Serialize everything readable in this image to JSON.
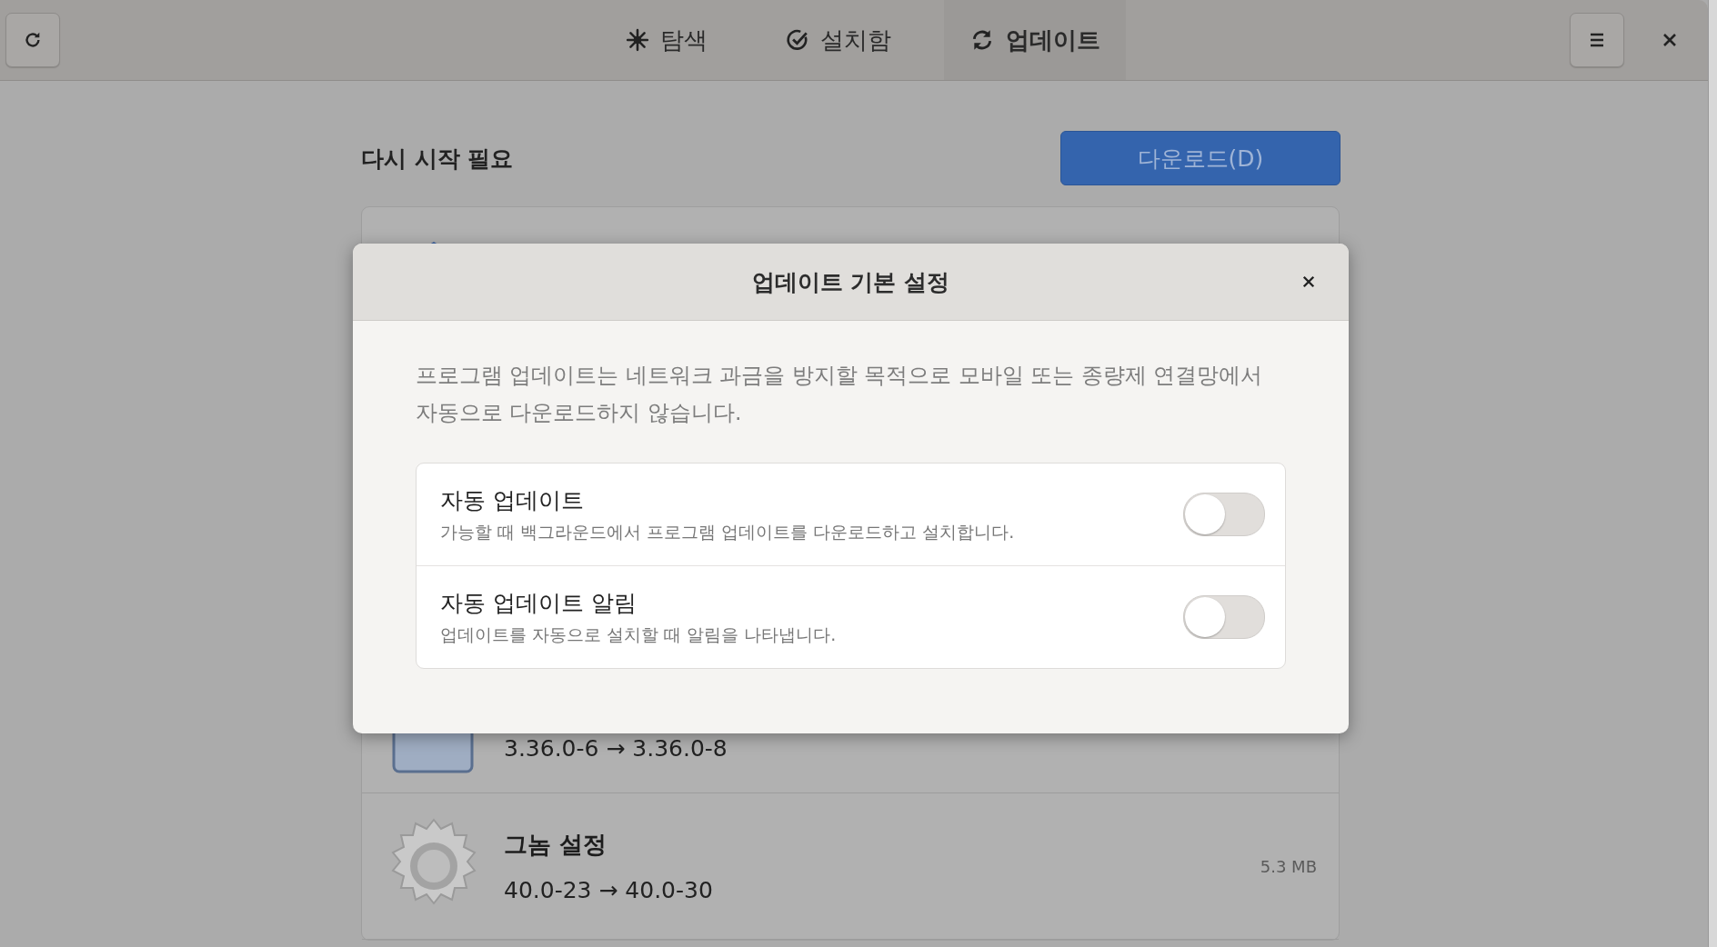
{
  "header": {
    "tabs": [
      {
        "label": "탐색",
        "kind": "explore",
        "selected": false
      },
      {
        "label": "설치함",
        "kind": "installed",
        "selected": false
      },
      {
        "label": "업데이트",
        "kind": "updates",
        "selected": true
      }
    ]
  },
  "section": {
    "title": "다시 시작 필요",
    "button": "다운로드(D)"
  },
  "updates": [
    {
      "kind": "box",
      "version": "3.36.0-6 → 3.36.0-8"
    },
    {
      "kind": "gear",
      "name": "그놈 설정",
      "version": "40.0-23 → 40.0-30",
      "size": "5.3 MB"
    }
  ],
  "dialog": {
    "title": "업데이트 기본 설정",
    "description": "프로그램 업데이트는 네트워크 과금을 방지할 목적으로 모바일 또는 종량제 연결망에서 자동으로 다운로드하지 않습니다.",
    "options": [
      {
        "title": "자동 업데이트",
        "description": "가능할 때 백그라운드에서 프로그램 업데이트를 다운로드하고 설치합니다.",
        "on": false
      },
      {
        "title": "자동 업데이트 알림",
        "description": "업데이트를 자동으로 설치할 때 알림을 나타냅니다.",
        "on": false
      }
    ]
  }
}
